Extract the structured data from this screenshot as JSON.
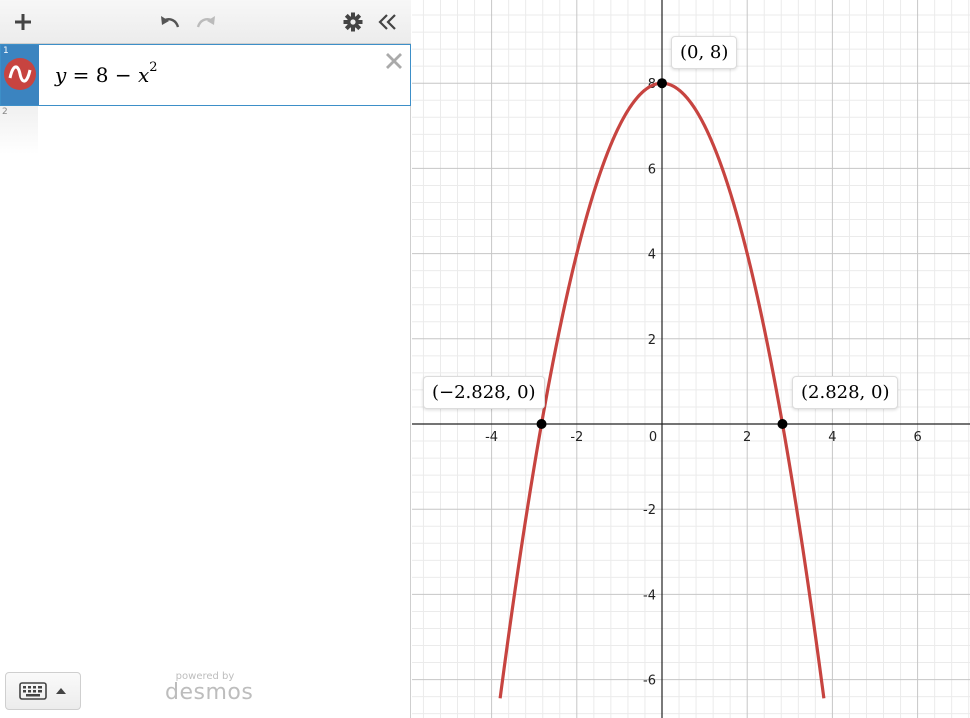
{
  "toolbar": {
    "add_icon": "plus-icon",
    "undo_icon": "undo-icon",
    "redo_icon": "redo-icon",
    "settings_icon": "gear-icon",
    "collapse_icon": "double-chevron-left-icon"
  },
  "expressions": [
    {
      "index": "1",
      "lhs": "y",
      "rhs_number": "8",
      "rhs_var": "x",
      "exponent": "2",
      "color": "#c74440"
    },
    {
      "index": "2"
    }
  ],
  "footer": {
    "powered_small": "powered by",
    "powered_big": "desmos"
  },
  "graph": {
    "x_ticks": [
      "-4",
      "-2",
      "0",
      "2",
      "4",
      "6"
    ],
    "y_ticks": [
      "8",
      "6",
      "4",
      "2",
      "-2",
      "-4",
      "-6"
    ],
    "curve_color": "#c74440",
    "points": [
      {
        "label": "(0, 8)",
        "x": 0,
        "y": 8
      },
      {
        "label": "(−2.828, 0)",
        "x": -2.828,
        "y": 0
      },
      {
        "label": "(2.828, 0)",
        "x": 2.828,
        "y": 0
      }
    ]
  },
  "chart_data": {
    "type": "line",
    "function": "y = 8 - x^2",
    "series": [
      {
        "x": [
          -3.7,
          -3,
          -2.828,
          -2,
          -1,
          0,
          1,
          2,
          2.828,
          3,
          3.7
        ],
        "y": [
          -5.69,
          -1,
          0,
          4,
          7,
          8,
          7,
          4,
          0,
          -1,
          -5.69
        ]
      }
    ],
    "xlim": [
      -5.8,
      7.2
    ],
    "ylim": [
      -6.7,
      9.9
    ],
    "grid": true
  }
}
